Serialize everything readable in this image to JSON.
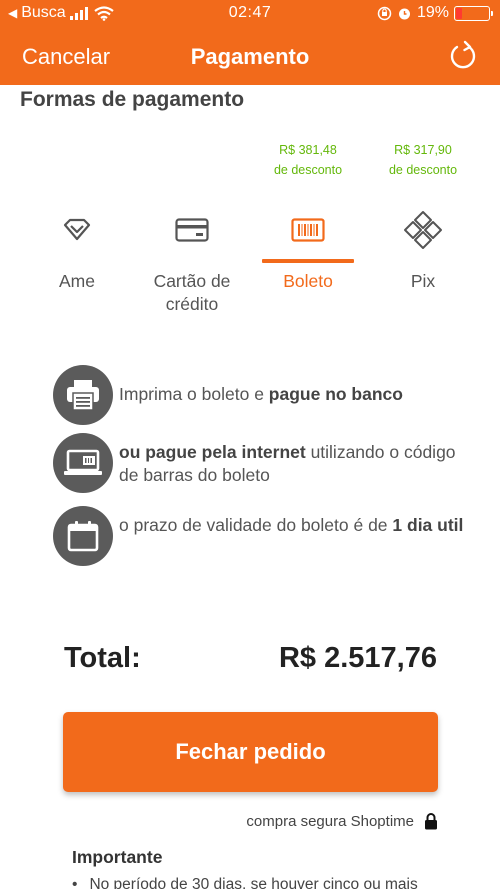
{
  "status_bar": {
    "back_app": "Busca",
    "time": "02:47",
    "battery": "19%"
  },
  "nav": {
    "cancel": "Cancelar",
    "title": "Pagamento",
    "refresh_icon": "refresh-icon"
  },
  "section_title": "Formas de pagamento",
  "discounts": {
    "boleto": {
      "amount": "R$ 381,48",
      "label": "de desconto"
    },
    "pix": {
      "amount": "R$ 317,90",
      "label": "de desconto"
    }
  },
  "tabs": [
    {
      "label": "Ame",
      "icon": "diamond-icon",
      "active": false
    },
    {
      "label_line1": "Cartão de",
      "label_line2": "crédito",
      "icon": "credit-card-icon",
      "active": false
    },
    {
      "label": "Boleto",
      "icon": "barcode-icon",
      "active": true
    },
    {
      "label": "Pix",
      "icon": "pix-icon",
      "active": false
    }
  ],
  "info": [
    {
      "icon": "printer-icon",
      "text1": "Imprima o boleto e ",
      "bold1": "pague no banco"
    },
    {
      "icon": "laptop-barcode-icon",
      "bold1": "ou pague pela internet",
      "text1": " utilizando o código de barras do boleto"
    },
    {
      "icon": "calendar-icon",
      "text1": "o prazo de validade do boleto é de ",
      "bold1": "1 dia util"
    }
  ],
  "total": {
    "label": "Total:",
    "value": "R$ 2.517,76"
  },
  "cta": "Fechar pedido",
  "secure_text": "compra segura Shoptime",
  "important": {
    "title": "Importante",
    "bullet": "No período de 30 dias, se houver cinco ou mais"
  },
  "colors": {
    "brand": "#f26a1b",
    "discount": "#64b80b",
    "icon_circle": "#5b5b5b"
  }
}
